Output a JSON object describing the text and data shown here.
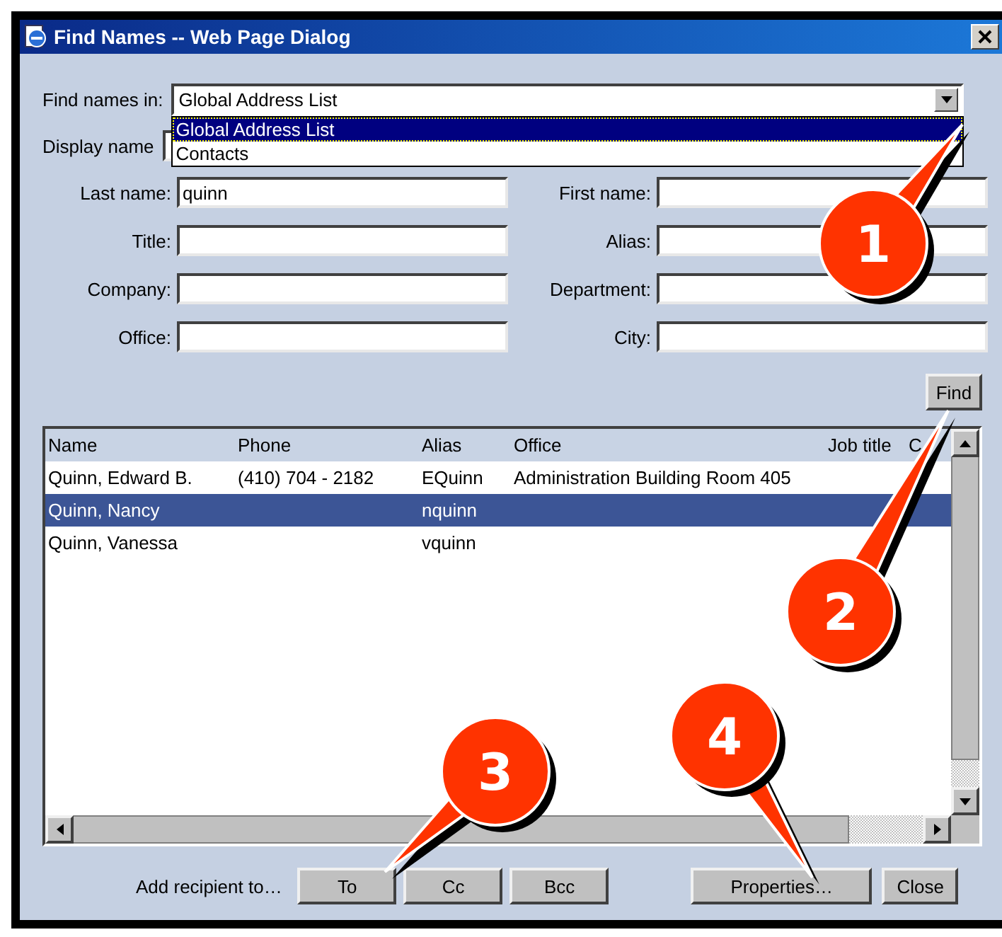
{
  "window": {
    "title": "Find Names -- Web Page Dialog"
  },
  "find_names_in": {
    "label": "Find names in:",
    "value": "Global Address List",
    "expanded": true,
    "options": [
      {
        "label": "Global Address List",
        "selected": true
      },
      {
        "label": "Contacts",
        "selected": false
      }
    ]
  },
  "display_name": {
    "label": "Display name"
  },
  "fields": [
    {
      "label": "Last name:",
      "value": "quinn"
    },
    {
      "label": "First name:"
    },
    {
      "label": "Title:"
    },
    {
      "label": "Alias:"
    },
    {
      "label": "Company:"
    },
    {
      "label": "Department:"
    },
    {
      "label": "Office:"
    },
    {
      "label": "City:"
    }
  ],
  "find_button": "Find",
  "results": {
    "columns": [
      "Name",
      "Phone",
      "Alias",
      "Office",
      "Job title",
      "C"
    ],
    "rows": [
      {
        "name": "Quinn, Edward B.",
        "phone": "(410) 704 - 2182",
        "alias": "EQuinn",
        "office": "Administration Building Room 405",
        "selected": false
      },
      {
        "name": "Quinn, Nancy",
        "alias": "nquinn",
        "selected": true
      },
      {
        "name": "Quinn, Vanessa",
        "alias": "vquinn",
        "selected": false
      }
    ]
  },
  "add_recipient_label": "Add recipient to…",
  "recipient_buttons": [
    "To",
    "Cc",
    "Bcc"
  ],
  "action_buttons": [
    "Properties…",
    "Close"
  ],
  "callouts": [
    {
      "number": "1"
    },
    {
      "number": "2"
    },
    {
      "number": "3"
    },
    {
      "number": "4"
    }
  ]
}
